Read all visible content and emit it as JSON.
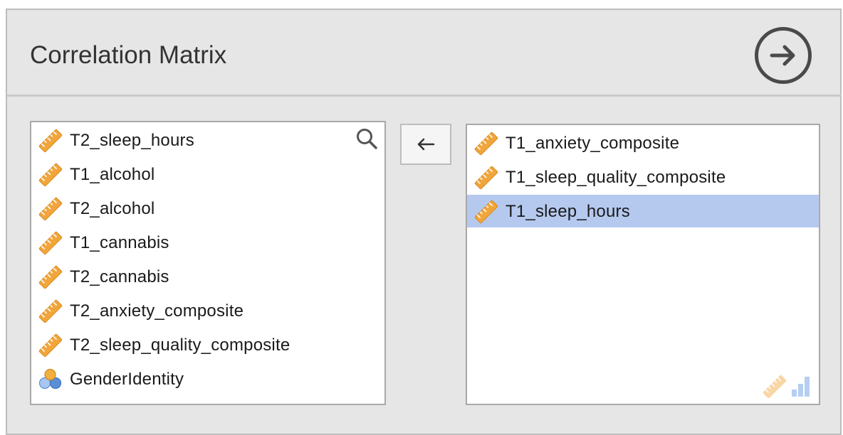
{
  "title": "Correlation Matrix",
  "run_button": {
    "icon": "arrow-right-circle-icon"
  },
  "move_button": {
    "label": "←",
    "icon": "arrow-left-icon"
  },
  "available_list": {
    "search_icon": "search-icon",
    "items": [
      {
        "label": "T2_sleep_hours",
        "type": "continuous"
      },
      {
        "label": "T1_alcohol",
        "type": "continuous"
      },
      {
        "label": "T2_alcohol",
        "type": "continuous"
      },
      {
        "label": "T1_cannabis",
        "type": "continuous"
      },
      {
        "label": "T2_cannabis",
        "type": "continuous"
      },
      {
        "label": "T2_anxiety_composite",
        "type": "continuous"
      },
      {
        "label": "T2_sleep_quality_composite",
        "type": "continuous"
      },
      {
        "label": "GenderIdentity",
        "type": "nominal"
      }
    ]
  },
  "selected_list": {
    "items": [
      {
        "label": "T1_anxiety_composite",
        "type": "continuous",
        "selected": false
      },
      {
        "label": "T1_sleep_quality_composite",
        "type": "continuous",
        "selected": false
      },
      {
        "label": "T1_sleep_hours",
        "type": "continuous",
        "selected": true
      }
    ],
    "allowed_types_icons": [
      "ruler-icon",
      "ordinal-bars-icon"
    ]
  },
  "colors": {
    "panel_bg": "#e6e6e6",
    "selection": "#b5c9ef",
    "ruler": "#f2a53a",
    "nominal": "#5b8fd6"
  }
}
